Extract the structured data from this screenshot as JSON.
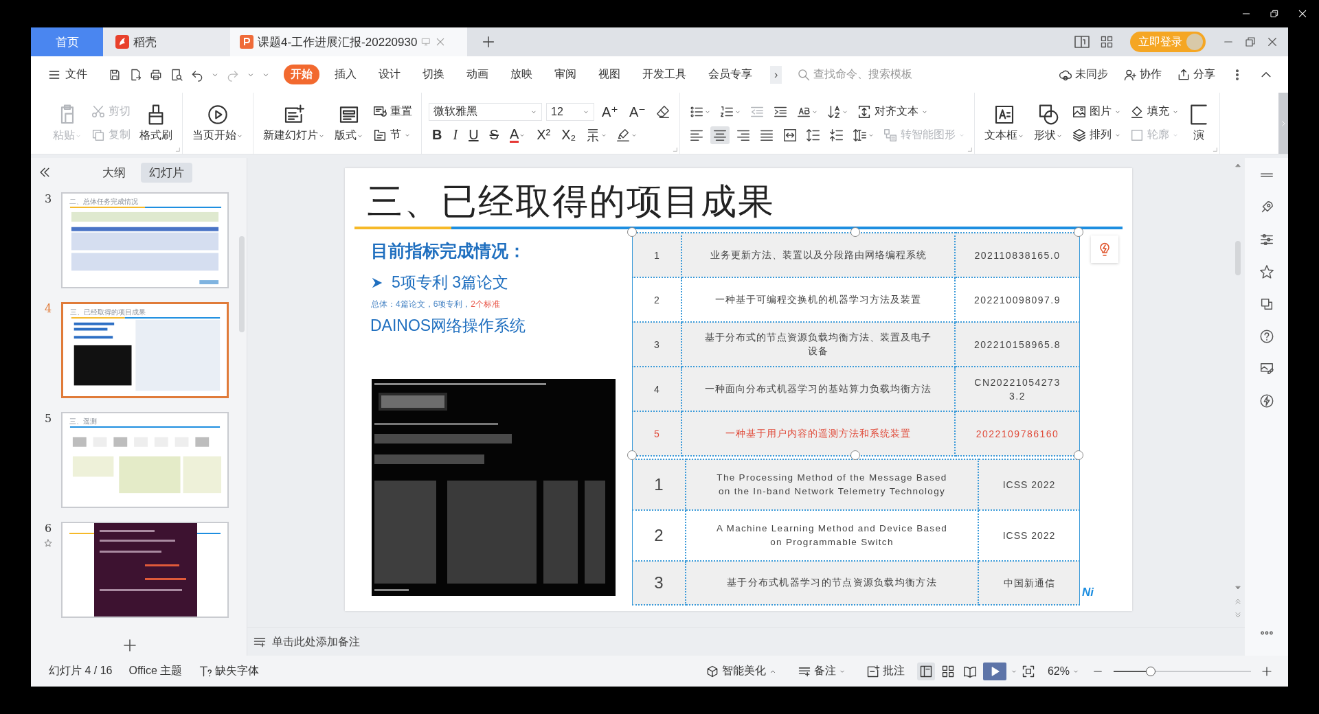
{
  "tab_bar": {
    "tabs": [
      {
        "label": "首页",
        "kind": "home",
        "selected": false
      },
      {
        "label": "稻壳",
        "kind": "app",
        "selected": false
      },
      {
        "label": "课题4-工作进展汇报-20220930",
        "kind": "document",
        "selected": true
      }
    ],
    "login": "立即登录"
  },
  "menu": {
    "file": "文件",
    "tabs": [
      {
        "label": "开始",
        "selected": true
      },
      {
        "label": "插入",
        "selected": false
      },
      {
        "label": "设计",
        "selected": false
      },
      {
        "label": "切换",
        "selected": false
      },
      {
        "label": "动画",
        "selected": false
      },
      {
        "label": "放映",
        "selected": false
      },
      {
        "label": "审阅",
        "selected": false
      },
      {
        "label": "视图",
        "selected": false
      },
      {
        "label": "开发工具",
        "selected": false
      },
      {
        "label": "会员专享",
        "selected": false
      }
    ],
    "more": "›",
    "search": {
      "placeholder": "查找命令、搜索模板"
    },
    "actions": [
      "未同步",
      "协作",
      "分享"
    ]
  },
  "ribbon": {
    "groups": [
      {
        "launcher": true,
        "columns": [
          [
            {
              "kind": "big",
              "label": "粘贴",
              "dropdown": true,
              "disabled": true
            }
          ],
          [
            {
              "kind": "small",
              "label": "剪切",
              "dropdown": false,
              "disabled": true
            },
            {
              "kind": "small",
              "label": "复制",
              "dropdown": false,
              "disabled": true
            }
          ],
          [
            {
              "kind": "big",
              "label": "格式刷",
              "dropdown": false,
              "disabled": false
            }
          ]
        ]
      },
      {
        "columns": [
          [
            {
              "kind": "big",
              "label": "当页开始",
              "dropdown": true,
              "disabled": false
            }
          ]
        ]
      },
      {
        "columns": [
          [
            {
              "kind": "big",
              "label": "新建幻灯片",
              "dropdown": true,
              "disabled": false
            }
          ],
          [
            {
              "kind": "big",
              "label": "版式",
              "dropdown": true,
              "disabled": false
            }
          ],
          [
            {
              "kind": "small",
              "label": "重置",
              "dropdown": false,
              "disabled": false
            },
            {
              "kind": "small",
              "label": "节",
              "dropdown": true,
              "disabled": false
            }
          ]
        ]
      },
      {
        "launcher": true,
        "top": [
          {
            "kind": "font",
            "value": "微软雅黑",
            "disabled": false
          },
          {
            "kind": "size",
            "value": "12",
            "disabled": false
          },
          {
            "kind": "glyph",
            "label": "A⁺",
            "dropdown": false,
            "disabled": false
          },
          {
            "kind": "glyph",
            "label": "A⁻",
            "dropdown": false,
            "disabled": false
          },
          {
            "kind": "icon",
            "dropdown": false,
            "disabled": false,
            "selected": false
          }
        ],
        "bottom": [
          {
            "kind": "glyph",
            "label": "B",
            "dropdown": false,
            "disabled": false
          },
          {
            "kind": "glyph",
            "label": "I",
            "dropdown": false,
            "disabled": false
          },
          {
            "kind": "glyph",
            "label": "U",
            "dropdown": false,
            "disabled": false
          },
          {
            "kind": "glyph",
            "label": "S",
            "dropdown": false,
            "disabled": false
          },
          {
            "kind": "glyph",
            "label": "A",
            "dropdown": true,
            "disabled": false
          },
          {
            "kind": "glyph",
            "label": "X²",
            "dropdown": false,
            "disabled": false
          },
          {
            "kind": "glyph",
            "label": "X₂",
            "dropdown": false,
            "disabled": false
          },
          {
            "kind": "icon",
            "dropdown": true,
            "disabled": false,
            "selected": false
          },
          {
            "kind": "icon",
            "dropdown": true,
            "disabled": false,
            "selected": false
          }
        ]
      },
      {
        "launcher": true,
        "top": [
          {
            "kind": "icon",
            "dropdown": true,
            "disabled": false,
            "selected": false
          },
          {
            "kind": "icon",
            "dropdown": true,
            "disabled": false,
            "selected": false
          },
          {
            "kind": "icon",
            "dropdown": false,
            "disabled": true,
            "selected": false
          },
          {
            "kind": "icon",
            "dropdown": false,
            "disabled": false,
            "selected": false
          },
          {
            "kind": "icon",
            "dropdown": true,
            "disabled": false,
            "selected": false
          },
          {
            "kind": "icon",
            "dropdown": true,
            "disabled": false,
            "selected": false
          },
          {
            "kind": "small",
            "label": "对齐文本",
            "dropdown": true,
            "disabled": false
          }
        ],
        "bottom": [
          {
            "kind": "icon",
            "dropdown": false,
            "disabled": false,
            "selected": false
          },
          {
            "kind": "icon",
            "dropdown": false,
            "disabled": false,
            "selected": true
          },
          {
            "kind": "icon",
            "dropdown": false,
            "disabled": false,
            "selected": false
          },
          {
            "kind": "icon",
            "dropdown": false,
            "disabled": false,
            "selected": false
          },
          {
            "kind": "icon",
            "dropdown": false,
            "disabled": false,
            "selected": false
          },
          {
            "kind": "icon",
            "dropdown": false,
            "disabled": false,
            "selected": false
          },
          {
            "kind": "icon",
            "dropdown": false,
            "disabled": false,
            "selected": false
          },
          {
            "kind": "icon",
            "dropdown": true,
            "disabled": false,
            "selected": false
          },
          {
            "kind": "small",
            "label": "转智能图形",
            "dropdown": true,
            "disabled": true
          }
        ]
      },
      {
        "launcher": true,
        "columns": [
          [
            {
              "kind": "big",
              "label": "文本框",
              "dropdown": true,
              "disabled": false
            }
          ],
          [
            {
              "kind": "big",
              "label": "形状",
              "dropdown": true,
              "disabled": false
            }
          ],
          [
            {
              "kind": "small",
              "label": "图片",
              "dropdown": true,
              "disabled": false
            },
            {
              "kind": "small",
              "label": "排列",
              "dropdown": true,
              "disabled": false
            }
          ],
          [
            {
              "kind": "small",
              "label": "填充",
              "dropdown": true,
              "disabled": false
            },
            {
              "kind": "small",
              "label": "轮廓",
              "dropdown": true,
              "disabled": true
            }
          ],
          [
            {
              "kind": "big",
              "label": "演",
              "dropdown": false,
              "disabled": false
            }
          ]
        ]
      }
    ]
  },
  "slide_panel": {
    "tabs": [
      {
        "label": "大纲",
        "selected": false
      },
      {
        "label": "幻灯片",
        "selected": true
      }
    ],
    "slides": [
      {
        "number": "3",
        "title": "二、总体任务完成情况",
        "kind": "table",
        "selected": false,
        "starred": false
      },
      {
        "number": "4",
        "title": "三、已经取得的项目成果",
        "kind": "results",
        "selected": true,
        "starred": false
      },
      {
        "number": "5",
        "title": "三、遥测",
        "kind": "diagram",
        "selected": false,
        "starred": false
      },
      {
        "number": "6",
        "kind": "terminal",
        "selected": false,
        "starred": true
      }
    ]
  },
  "slide": {
    "title": "三、已经取得的项目成果",
    "heading": "目前指标完成情况：",
    "bullet": "5项专利  3篇论文",
    "note": {
      "text": "总体：4篇论文，6项专利，",
      "emphasis": "2个标准"
    },
    "system": "DAINOS网络操作系统",
    "patents": {
      "selected": true,
      "rows": [
        {
          "number": "1",
          "title": "业务更新方法、装置以及分段路由网络编程系统",
          "id": "202110838165.0",
          "shaded": true,
          "highlighted": false
        },
        {
          "number": "2",
          "title": "一种基于可编程交换机的机器学习方法及装置",
          "id": "202210098097.9",
          "shaded": false,
          "highlighted": false
        },
        {
          "number": "3",
          "title": "基于分布式的节点资源负载均衡方法、装置及电子设备",
          "id": "202210158965.8",
          "shaded": true,
          "highlighted": false
        },
        {
          "number": "4",
          "title": "一种面向分布式机器学习的基站算力负载均衡方法",
          "id": "CN202210542733.2",
          "shaded": true,
          "highlighted": false
        },
        {
          "number": "5",
          "title": "一种基于用户内容的遥测方法和系统装置",
          "id": "2022109786160",
          "shaded": true,
          "highlighted": true
        }
      ]
    },
    "papers": {
      "rows": [
        {
          "number": "1",
          "title": "The Processing Method of the Message Based on the In-band Network Telemetry Technology",
          "venue": "ICSS 2022",
          "shaded": true,
          "highlighted": false
        },
        {
          "number": "2",
          "title": "A Machine Learning Method and Device Based on Programmable Switch",
          "venue": "ICSS 2022",
          "shaded": false,
          "highlighted": false
        },
        {
          "number": "3",
          "title": "基于分布式机器学习的节点资源负载均衡方法",
          "venue": "中国新通信",
          "shaded": true,
          "highlighted": false
        }
      ]
    },
    "logo_fragment": "Ni"
  },
  "notes": {
    "placeholder": "单击此处添加备注"
  },
  "status_bar": {
    "slide": "幻灯片 4 / 16",
    "theme": "Office 主题",
    "missing_font": "缺失字体",
    "beautify": "智能美化",
    "notes": "备注",
    "comments": "批注",
    "views": [
      {
        "selected": true
      },
      {
        "selected": false
      },
      {
        "selected": false
      }
    ],
    "zoom": "62%",
    "zoom_slider": {
      "level": 0.27
    }
  }
}
